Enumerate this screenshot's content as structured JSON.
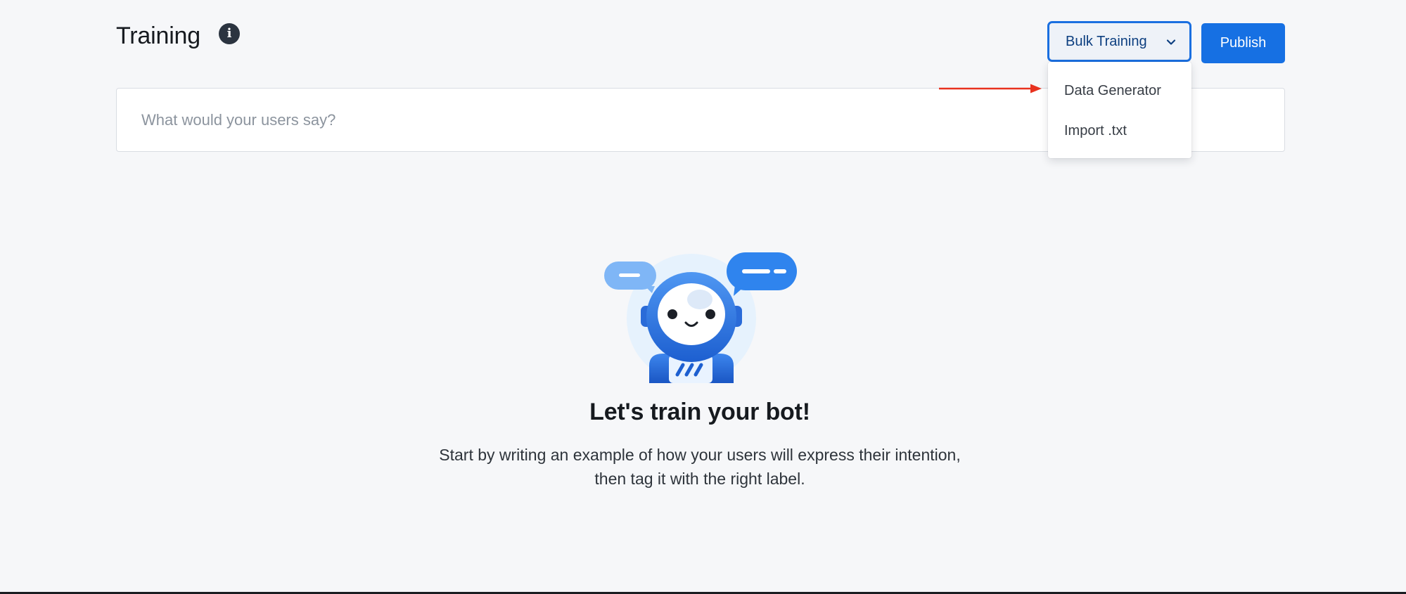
{
  "header": {
    "title": "Training",
    "info_icon": "info-icon"
  },
  "toolbar": {
    "bulk_training_label": "Bulk Training",
    "bulk_training_icon": "chevron-down-icon",
    "publish_label": "Publish"
  },
  "bulk_training_menu": {
    "items": [
      {
        "label": "Data Generator"
      },
      {
        "label": "Import .txt"
      }
    ]
  },
  "search": {
    "placeholder": "What would your users say?",
    "value": ""
  },
  "empty_state": {
    "illustration": "robot-illustration",
    "heading": "Let's train your bot!",
    "description_line1": "Start by writing an example of how your users will express their intention,",
    "description_line2": "then tag it with the right label."
  },
  "annotation": {
    "icon": "red-arrow-icon",
    "color": "#e8321f"
  },
  "colors": {
    "accent": "#1670e3",
    "background": "#f6f7f9",
    "text": "#161a1f"
  }
}
